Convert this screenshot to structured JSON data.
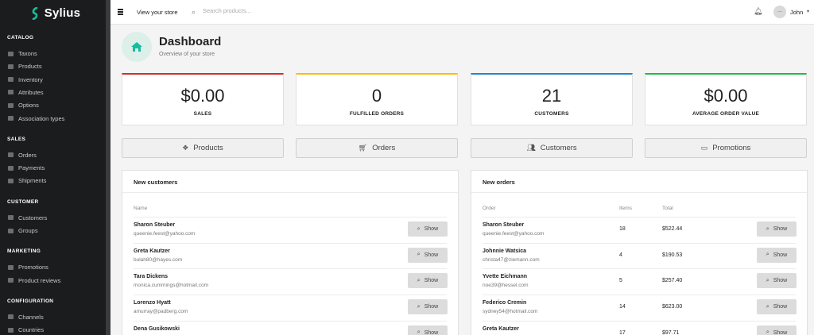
{
  "brand": {
    "name": "Sylius",
    "color": "#1abb9c"
  },
  "sidebar": {
    "sections": [
      {
        "title": "CATALOG",
        "items": [
          {
            "label": "Taxons",
            "icon": "folder-icon"
          },
          {
            "label": "Products",
            "icon": "cubes-icon"
          },
          {
            "label": "Inventory",
            "icon": "history-icon"
          },
          {
            "label": "Attributes",
            "icon": "tag-icon"
          },
          {
            "label": "Options",
            "icon": "options-icon"
          },
          {
            "label": "Association types",
            "icon": "list-icon"
          }
        ]
      },
      {
        "title": "SALES",
        "items": [
          {
            "label": "Orders",
            "icon": "cart-icon"
          },
          {
            "label": "Payments",
            "icon": "payment-icon"
          },
          {
            "label": "Shipments",
            "icon": "truck-icon"
          }
        ]
      },
      {
        "title": "CUSTOMER",
        "items": [
          {
            "label": "Customers",
            "icon": "users-icon"
          },
          {
            "label": "Groups",
            "icon": "archive-icon"
          }
        ]
      },
      {
        "title": "MARKETING",
        "items": [
          {
            "label": "Promotions",
            "icon": "percent-icon"
          },
          {
            "label": "Product reviews",
            "icon": "newspaper-icon"
          }
        ]
      },
      {
        "title": "CONFIGURATION",
        "items": [
          {
            "label": "Channels",
            "icon": "share-icon"
          },
          {
            "label": "Countries",
            "icon": "flag-icon"
          }
        ]
      }
    ]
  },
  "topbar": {
    "view_store": "View your store",
    "search_placeholder": "Search products...",
    "user_name": "John",
    "avatar_text": "—"
  },
  "header": {
    "title": "Dashboard",
    "subtitle": "Overview of your store"
  },
  "stats": [
    {
      "value": "$0.00",
      "label": "SALES",
      "color": "#db2828"
    },
    {
      "value": "0",
      "label": "FULFILLED ORDERS",
      "color": "#fbbd08"
    },
    {
      "value": "21",
      "label": "CUSTOMERS",
      "color": "#2185d0"
    },
    {
      "value": "$0.00",
      "label": "AVERAGE ORDER VALUE",
      "color": "#21ba45"
    }
  ],
  "nav_buttons": [
    {
      "label": "Products",
      "icon": "cubes-icon"
    },
    {
      "label": "Orders",
      "icon": "cart-icon"
    },
    {
      "label": "Customers",
      "icon": "users-icon"
    },
    {
      "label": "Promotions",
      "icon": "promotion-icon"
    }
  ],
  "new_customers": {
    "title": "New customers",
    "columns": [
      "Name"
    ],
    "rows": [
      {
        "name": "Sharon Steuber",
        "email": "queenie.feest@yahoo.com"
      },
      {
        "name": "Greta Kautzer",
        "email": "bulah80@hayes.com"
      },
      {
        "name": "Tara Dickens",
        "email": "monica.cummings@hotmail.com"
      },
      {
        "name": "Lorenzo Hyatt",
        "email": "amurray@padberg.com"
      },
      {
        "name": "Dena Gusikowski",
        "email": ""
      }
    ]
  },
  "new_orders": {
    "title": "New orders",
    "columns": [
      "Order",
      "Items",
      "Total"
    ],
    "rows": [
      {
        "name": "Sharon Steuber",
        "email": "queenie.feest@yahoo.com",
        "items": "18",
        "total": "$522.44"
      },
      {
        "name": "Johnnie Watsica",
        "email": "christa47@ziemann.com",
        "items": "4",
        "total": "$190.53"
      },
      {
        "name": "Yvette Eichmann",
        "email": "noe39@hessel.com",
        "items": "5",
        "total": "$257.40"
      },
      {
        "name": "Federico Cremin",
        "email": "sydney54@hotmail.com",
        "items": "14",
        "total": "$623.00"
      },
      {
        "name": "Greta Kautzer",
        "email": "",
        "items": "17",
        "total": "$97.71"
      }
    ]
  },
  "show_label": "Show"
}
